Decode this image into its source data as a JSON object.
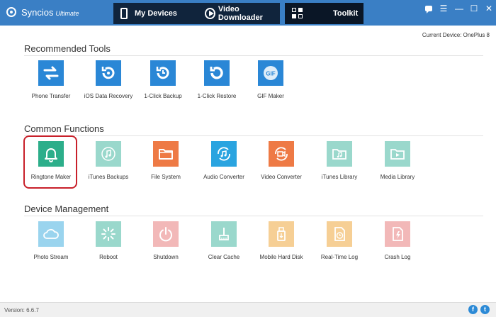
{
  "app": {
    "name": "Syncios",
    "edition": "Ultimate"
  },
  "nav": {
    "my_devices": "My Devices",
    "video_downloader": "Video Downloader",
    "toolkit": "Toolkit"
  },
  "window_controls": [
    "chat-icon",
    "menu-icon",
    "minimize-icon",
    "maximize-icon",
    "close-icon"
  ],
  "current_device": "Current Device: OnePlus 8",
  "sections": {
    "recommended": {
      "title": "Recommended Tools",
      "tools": [
        {
          "label": "Phone Transfer",
          "icon": "transfer-arrows-icon",
          "color": "#2a87d6"
        },
        {
          "label": "iOS Data Recovery",
          "icon": "recovery-icon",
          "color": "#2a87d6"
        },
        {
          "label": "1-Click Backup",
          "icon": "backup-clock-icon",
          "color": "#2a87d6"
        },
        {
          "label": "1-Click Restore",
          "icon": "restore-icon",
          "color": "#2a87d6"
        },
        {
          "label": "GIF Maker",
          "icon": "gif-icon",
          "color": "#2a87d6"
        }
      ]
    },
    "common": {
      "title": "Common Functions",
      "tools": [
        {
          "label": "Ringtone Maker",
          "icon": "bell-icon",
          "color": "#2cae8a"
        },
        {
          "label": "iTunes Backups",
          "icon": "music-note-icon",
          "color": "#9ad8cc"
        },
        {
          "label": "File System",
          "icon": "folder-icon",
          "color": "#ee7a45"
        },
        {
          "label": "Audio Converter",
          "icon": "audio-convert-icon",
          "color": "#2aa4e0"
        },
        {
          "label": "Video Converter",
          "icon": "video-convert-icon",
          "color": "#ee7a45"
        },
        {
          "label": "iTunes Library",
          "icon": "music-folder-icon",
          "color": "#9ad8cc"
        },
        {
          "label": "Media Library",
          "icon": "media-folder-icon",
          "color": "#9ad8cc"
        }
      ]
    },
    "device": {
      "title": "Device Management",
      "tools": [
        {
          "label": "Photo Stream",
          "icon": "cloud-icon",
          "color": "#9ad4ee"
        },
        {
          "label": "Reboot",
          "icon": "reboot-icon",
          "color": "#9ad8cc"
        },
        {
          "label": "Shutdown",
          "icon": "power-icon",
          "color": "#f2b8b8"
        },
        {
          "label": "Clear Cache",
          "icon": "broom-icon",
          "color": "#9ad8cc"
        },
        {
          "label": "Mobile Hard Disk",
          "icon": "usb-disk-icon",
          "color": "#f6cf95"
        },
        {
          "label": "Real-Time Log",
          "icon": "log-clock-icon",
          "color": "#f6cf95"
        },
        {
          "label": "Crash Log",
          "icon": "crash-log-icon",
          "color": "#f2b8b8"
        }
      ]
    }
  },
  "footer": {
    "version": "Version: 6.6.7",
    "facebook": "f",
    "twitter": "t"
  }
}
